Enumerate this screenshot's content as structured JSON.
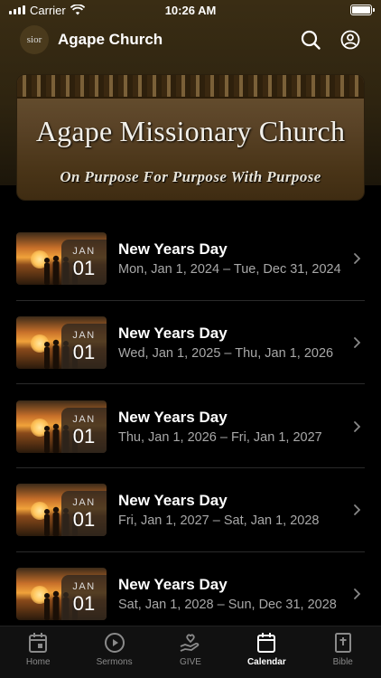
{
  "status_bar": {
    "carrier": "Carrier",
    "time": "10:26 AM"
  },
  "header": {
    "avatar_text": "sior",
    "title": "Agape Church"
  },
  "banner": {
    "title": "Agape Missionary Church",
    "subtitle": "On Purpose For Purpose With Purpose"
  },
  "events": [
    {
      "title": "New Years Day",
      "dates": "Mon, Jan 1, 2024 – Tue, Dec 31, 2024",
      "month": "JAN",
      "day": "01"
    },
    {
      "title": "New Years Day",
      "dates": "Wed, Jan 1, 2025 – Thu, Jan 1, 2026",
      "month": "JAN",
      "day": "01"
    },
    {
      "title": "New Years Day",
      "dates": "Thu, Jan 1, 2026 – Fri, Jan 1, 2027",
      "month": "JAN",
      "day": "01"
    },
    {
      "title": "New Years Day",
      "dates": "Fri, Jan 1, 2027 – Sat, Jan 1, 2028",
      "month": "JAN",
      "day": "01"
    },
    {
      "title": "New Years Day",
      "dates": "Sat, Jan 1, 2028 – Sun, Dec 31, 2028",
      "month": "JAN",
      "day": "01"
    }
  ],
  "tabs": [
    {
      "label": "Home",
      "icon": "home-icon"
    },
    {
      "label": "Sermons",
      "icon": "play-icon"
    },
    {
      "label": "GIVE",
      "icon": "give-icon"
    },
    {
      "label": "Calendar",
      "icon": "calendar-icon",
      "active": true
    },
    {
      "label": "Bible",
      "icon": "bible-icon"
    }
  ]
}
